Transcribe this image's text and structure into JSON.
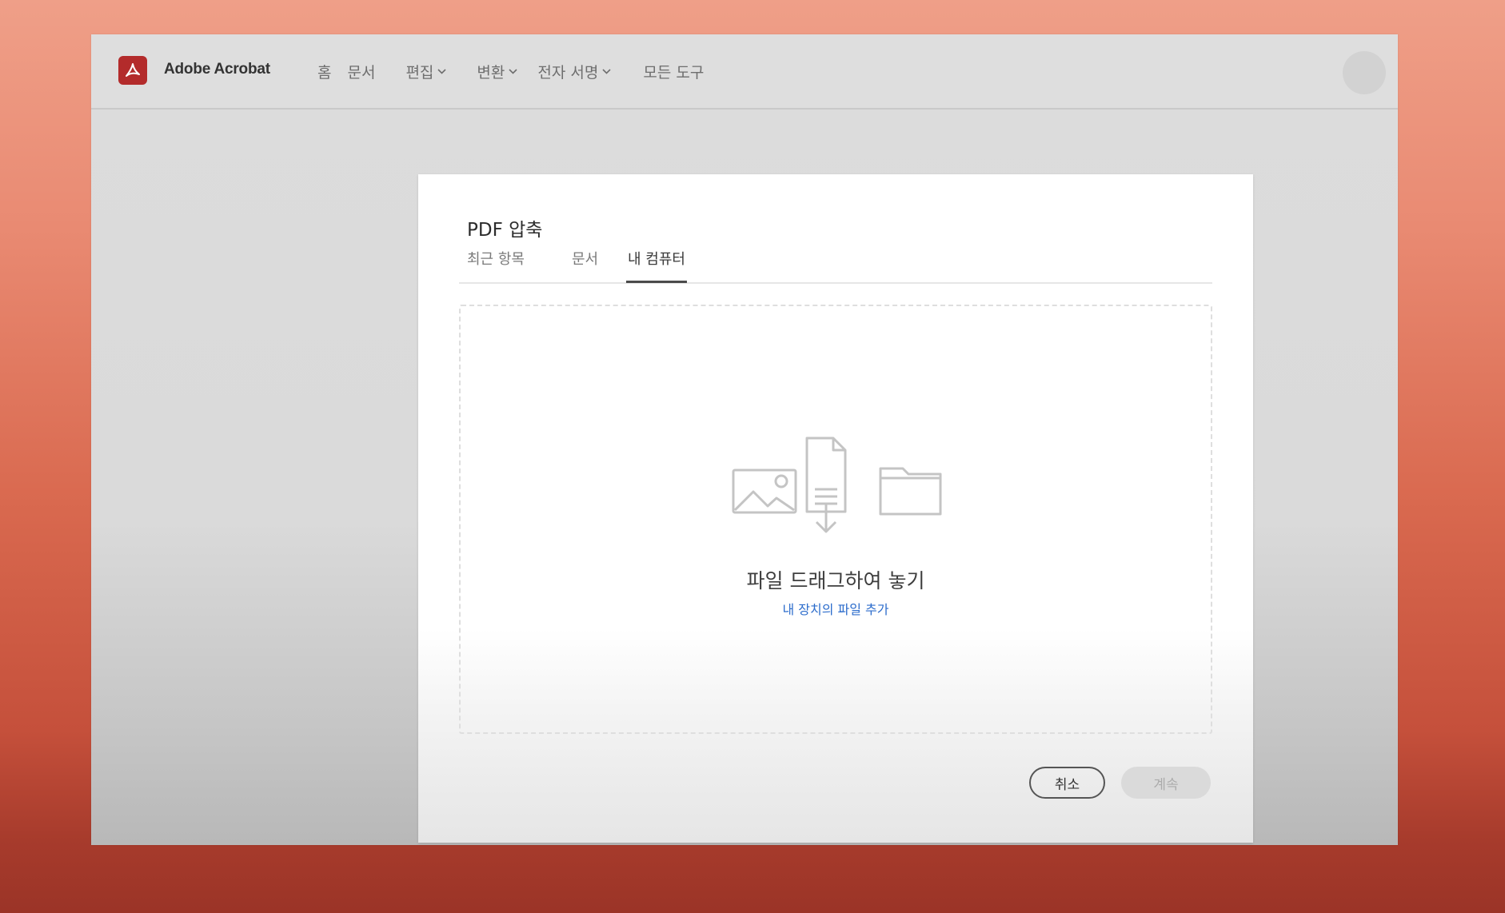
{
  "app": {
    "name": "Adobe Acrobat",
    "logo_icon": "acrobat-logo-icon",
    "brand_color": "#b32b2b"
  },
  "nav": {
    "items": [
      {
        "label": "홈",
        "has_dropdown": false
      },
      {
        "label": "문서",
        "has_dropdown": false
      },
      {
        "label": "편집",
        "has_dropdown": true
      },
      {
        "label": "변환",
        "has_dropdown": true
      },
      {
        "label": "전자 서명",
        "has_dropdown": true
      },
      {
        "label": "모든 도구",
        "has_dropdown": false
      }
    ]
  },
  "dialog": {
    "title": "PDF 압축",
    "tabs": [
      {
        "label": "최근 항목",
        "active": false
      },
      {
        "label": "문서",
        "active": false
      },
      {
        "label": "내 컴퓨터",
        "active": true
      }
    ],
    "dropzone": {
      "heading": "파일 드래그하여 놓기",
      "link": "내 장치의 파일 추가",
      "icons": [
        "image-icon",
        "document-download-icon",
        "folder-icon"
      ]
    },
    "buttons": {
      "cancel": "취소",
      "continue": "계속"
    },
    "link_color": "#2d6dcc"
  }
}
